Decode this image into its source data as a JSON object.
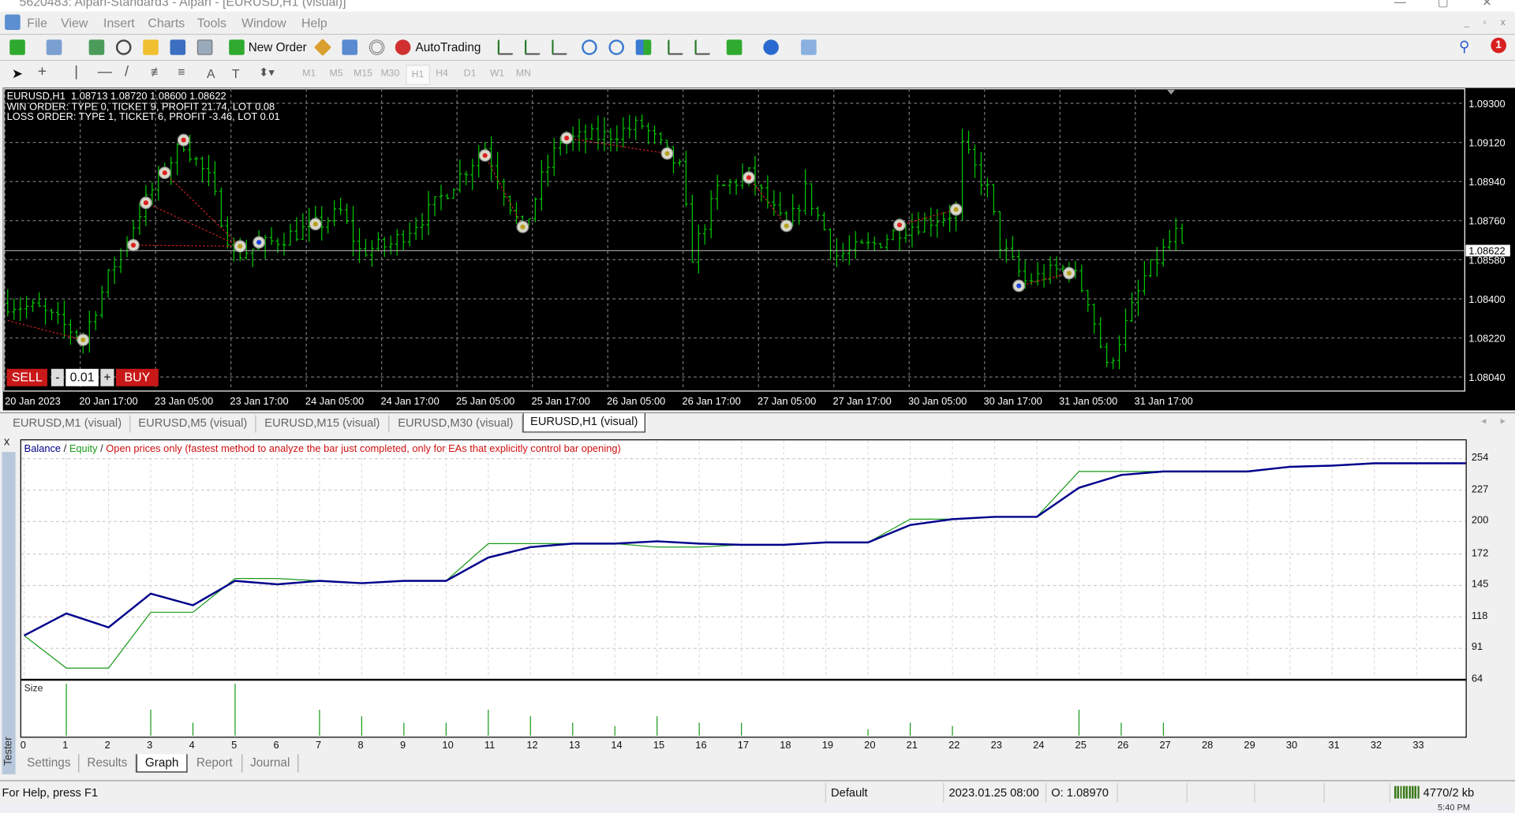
{
  "window": {
    "title": "5620483: Alpari-Standard3 - Alpari - [EURUSD,H1 (visual)]"
  },
  "menu": [
    "File",
    "View",
    "Insert",
    "Charts",
    "Tools",
    "Window",
    "Help"
  ],
  "toolbar": {
    "new_order": "New Order",
    "autotrading": "AutoTrading",
    "notification_count": "1",
    "timeframes": [
      "M1",
      "M5",
      "M15",
      "M30",
      "H1",
      "H4",
      "D1",
      "W1",
      "MN"
    ],
    "active_timeframe": "H1"
  },
  "chart": {
    "info_lines": [
      "EURUSD,H1  1.08713 1.08720 1.08600 1.08622",
      "WIN ORDER: TYPE 0, TICKET 9, PROFIT 21.74, LOT 0.08",
      "LOSS ORDER: TYPE 1, TICKET 6, PROFIT -3.46, LOT 0.01"
    ],
    "sell_label": "SELL",
    "buy_label": "BUY",
    "minus": "-",
    "plus": "+",
    "lot": "0.01",
    "current_price": "1.08622",
    "price_ticks": [
      "1.09300",
      "1.09120",
      "1.08940",
      "1.08760",
      "1.08580",
      "1.08400",
      "1.08220",
      "1.08040"
    ],
    "time_labels": [
      "20 Jan 2023",
      "20 Jan 17:00",
      "23 Jan 05:00",
      "23 Jan 17:00",
      "24 Jan 05:00",
      "24 Jan 17:00",
      "25 Jan 05:00",
      "25 Jan 17:00",
      "26 Jan 05:00",
      "26 Jan 17:00",
      "27 Jan 05:00",
      "27 Jan 17:00",
      "30 Jan 05:00",
      "30 Jan 17:00",
      "31 Jan 05:00",
      "31 Jan 17:00"
    ],
    "price_keypoints": [
      [
        0,
        1.0838
      ],
      [
        5,
        1.0835
      ],
      [
        12,
        1.0822
      ],
      [
        16,
        1.085
      ],
      [
        21,
        1.088
      ],
      [
        25,
        1.09
      ],
      [
        28,
        1.0912
      ],
      [
        32,
        1.0895
      ],
      [
        36,
        1.086
      ],
      [
        41,
        1.0865
      ],
      [
        50,
        1.0875
      ],
      [
        53,
        1.088
      ],
      [
        56,
        1.0862
      ],
      [
        61,
        1.0865
      ],
      [
        67,
        1.088
      ],
      [
        76,
        1.091
      ],
      [
        82,
        1.087
      ],
      [
        85,
        1.0895
      ],
      [
        88,
        1.0913
      ],
      [
        95,
        1.0915
      ],
      [
        101,
        1.092
      ],
      [
        107,
        1.09
      ],
      [
        109,
        1.086
      ],
      [
        113,
        1.089
      ],
      [
        118,
        1.0897
      ],
      [
        124,
        1.0872
      ],
      [
        127,
        1.089
      ],
      [
        132,
        1.086
      ],
      [
        138,
        1.0865
      ],
      [
        142,
        1.0872
      ],
      [
        151,
        1.088
      ],
      [
        152,
        1.091
      ],
      [
        156,
        1.089
      ],
      [
        158,
        1.0865
      ],
      [
        162,
        1.0848
      ],
      [
        169,
        1.0855
      ],
      [
        172,
        1.084
      ],
      [
        175,
        1.0808
      ],
      [
        178,
        1.0828
      ],
      [
        181,
        1.085
      ],
      [
        186,
        1.087
      ],
      [
        187,
        1.0862
      ]
    ],
    "trade_markers": [
      {
        "bar": 12,
        "price": 1.08211,
        "type": "close"
      },
      {
        "bar": 20,
        "price": 1.08647,
        "type": "sell"
      },
      {
        "bar": 22,
        "price": 1.08842,
        "type": "sell"
      },
      {
        "bar": 25,
        "price": 1.0898,
        "type": "sell"
      },
      {
        "bar": 28,
        "price": 1.09131,
        "type": "sell"
      },
      {
        "bar": 37,
        "price": 1.08642,
        "type": "close"
      },
      {
        "bar": 40,
        "price": 1.0866,
        "type": "buy"
      },
      {
        "bar": 49,
        "price": 1.08744,
        "type": "close"
      },
      {
        "bar": 76,
        "price": 1.0906,
        "type": "sell"
      },
      {
        "bar": 82,
        "price": 1.08731,
        "type": "close"
      },
      {
        "bar": 89,
        "price": 1.0914,
        "type": "sell"
      },
      {
        "bar": 105,
        "price": 1.09069,
        "type": "close"
      },
      {
        "bar": 118,
        "price": 1.08958,
        "type": "sell"
      },
      {
        "bar": 124,
        "price": 1.08736,
        "type": "close"
      },
      {
        "bar": 142,
        "price": 1.0874,
        "type": "sell"
      },
      {
        "bar": 151,
        "price": 1.08811,
        "type": "close"
      },
      {
        "bar": 161,
        "price": 1.0846,
        "type": "buy"
      },
      {
        "bar": 169,
        "price": 1.08518,
        "type": "close"
      }
    ],
    "trade_lines": [
      [
        20,
        1.08647,
        37,
        1.08642
      ],
      [
        22,
        1.08842,
        37,
        1.08642
      ],
      [
        25,
        1.0898,
        37,
        1.08642
      ],
      [
        76,
        1.0906,
        82,
        1.08731
      ],
      [
        89,
        1.0914,
        105,
        1.09069
      ],
      [
        118,
        1.08958,
        124,
        1.08736
      ],
      [
        142,
        1.0874,
        151,
        1.08811
      ],
      [
        161,
        1.0846,
        169,
        1.08518
      ],
      [
        0,
        1.083,
        12,
        1.08211
      ]
    ],
    "bar_color": "#00c800"
  },
  "chart_tabs": [
    "EURUSD,M1 (visual)",
    "EURUSD,M5 (visual)",
    "EURUSD,M15 (visual)",
    "EURUSD,M30 (visual)",
    "EURUSD,H1 (visual)"
  ],
  "active_chart_tab": "EURUSD,H1 (visual)",
  "tester": {
    "side_label": "Tester",
    "close": "x",
    "legend": {
      "balance": "Balance",
      "equity": "Equity",
      "sep": " / ",
      "mode": "Open prices only (fastest method to analyze the bar just completed, only for EAs that explicitly control bar opening)"
    },
    "size_label": "Size",
    "tabs": [
      "Settings",
      "Results",
      "Graph",
      "Report",
      "Journal"
    ],
    "active_tab": "Graph"
  },
  "chart_data": {
    "type": "line",
    "x": [
      0,
      1,
      2,
      3,
      4,
      5,
      6,
      7,
      8,
      9,
      10,
      11,
      12,
      13,
      14,
      15,
      16,
      17,
      18,
      19,
      20,
      21,
      22,
      23,
      24,
      25,
      26,
      27,
      28,
      29,
      30,
      31,
      32,
      33
    ],
    "x_ticks": [
      "0",
      "1",
      "2",
      "3",
      "4",
      "5",
      "6",
      "7",
      "8",
      "9",
      "10",
      "11",
      "12",
      "13",
      "14",
      "15",
      "16",
      "17",
      "18",
      "19",
      "20",
      "21",
      "22",
      "23",
      "24",
      "25",
      "26",
      "27",
      "28",
      "29",
      "30",
      "31",
      "32",
      "33"
    ],
    "y_ticks": [
      "254",
      "227",
      "200",
      "172",
      "145",
      "118",
      "91",
      "64"
    ],
    "ylim": [
      64,
      254
    ],
    "series": [
      {
        "name": "Balance",
        "color": "#00008b",
        "values": [
          102,
          121,
          109,
          138,
          128,
          149,
          146,
          149,
          147,
          149,
          149,
          169,
          178,
          181,
          181,
          183,
          181,
          180,
          180,
          182,
          182,
          197,
          202,
          204,
          204,
          229,
          240,
          243,
          243,
          243,
          247,
          248,
          250,
          250
        ]
      },
      {
        "name": "Equity",
        "color": "#1a9a1a",
        "values": [
          102,
          74,
          74,
          122,
          122,
          151,
          151,
          149,
          147,
          149,
          149,
          181,
          181,
          181,
          181,
          178,
          178,
          180,
          180,
          182,
          182,
          202,
          202,
          204,
          204,
          243,
          243,
          243,
          243,
          243,
          247,
          248,
          250,
          250
        ]
      }
    ],
    "size_bars": {
      "color": "#1a9a1a",
      "values": [
        0,
        0.08,
        0,
        0.04,
        0.02,
        0.08,
        0,
        0.04,
        0.03,
        0.02,
        0.02,
        0.04,
        0.03,
        0.02,
        0.015,
        0.03,
        0.02,
        0.02,
        0,
        0,
        0.01,
        0.02,
        0.015,
        0,
        0,
        0.04,
        0.02,
        0.02,
        0,
        0,
        0,
        0,
        0,
        0
      ]
    }
  },
  "status": {
    "help": "For Help, press F1",
    "profile": "Default",
    "datetime": "2023.01.25 08:00",
    "open": "O: 1.08970",
    "traffic": "4770/2 kb",
    "clock": "5:40 PM"
  }
}
